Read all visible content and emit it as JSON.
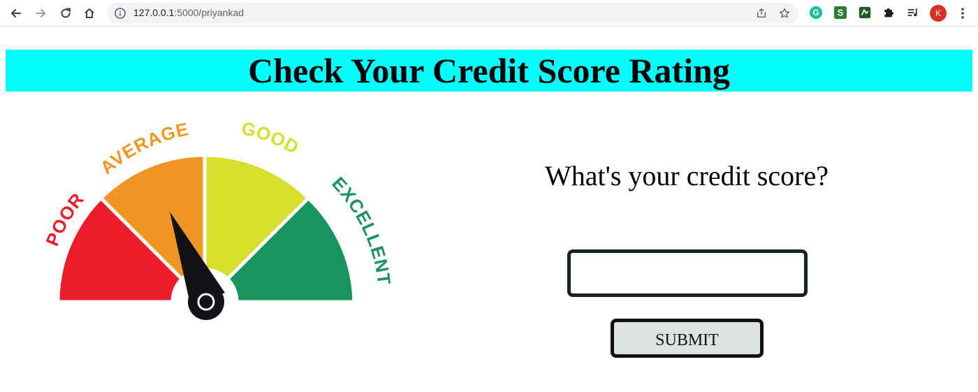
{
  "browser": {
    "url_host": "127.0.0.1",
    "url_path": ":5000/priyankad",
    "profile_initial": "K"
  },
  "page": {
    "title": "Check Your Credit Score Rating",
    "question": "What's your credit score?",
    "input_value": "",
    "submit_label": "SUBMIT"
  },
  "gauge": {
    "labels": {
      "poor": "POOR",
      "average": "AVERAGE",
      "good": "GOOD",
      "excellent": "EXCELLENT"
    },
    "colors": {
      "poor": "#ed1c2a",
      "average": "#f39524",
      "good": "#d6e02c",
      "excellent": "#1a945f",
      "needle": "#111318"
    },
    "needle_segment": "average"
  },
  "colors": {
    "banner": "#00ffff",
    "button_bg": "#dee2e1"
  }
}
